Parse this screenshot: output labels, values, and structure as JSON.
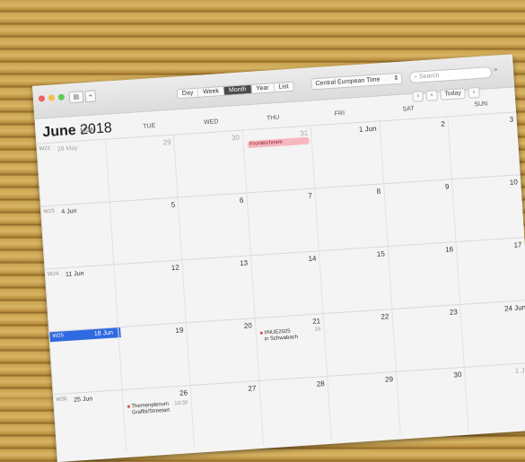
{
  "toolbar": {
    "views": [
      "Day",
      "Week",
      "Month",
      "Year",
      "List"
    ],
    "active_view": "Month",
    "timezone": "Central European Time",
    "search_placeholder": "Search",
    "today_label": "Today",
    "more": "»"
  },
  "title": {
    "month": "June",
    "year": "2018"
  },
  "dayheads": [
    "MON",
    "TUE",
    "WED",
    "THU",
    "FRI",
    "SAT",
    "SUN"
  ],
  "weeks": [
    {
      "label": "W22",
      "days": [
        {
          "n": "28 May",
          "muted": true
        },
        {
          "n": "29",
          "muted": true
        },
        {
          "n": "30",
          "muted": true
        },
        {
          "n": "31",
          "muted": true
        },
        {
          "n": "1 Jun"
        },
        {
          "n": "2"
        },
        {
          "n": "3"
        }
      ]
    },
    {
      "label": "W23",
      "days": [
        {
          "n": "4 Jun",
          "muted": false
        },
        {
          "n": "5"
        },
        {
          "n": "6"
        },
        {
          "n": "7"
        },
        {
          "n": "8"
        },
        {
          "n": "9"
        },
        {
          "n": "10"
        }
      ]
    },
    {
      "label": "W24",
      "days": [
        {
          "n": "11 Jun"
        },
        {
          "n": "12"
        },
        {
          "n": "13"
        },
        {
          "n": "14"
        },
        {
          "n": "15"
        },
        {
          "n": "16"
        },
        {
          "n": "17"
        }
      ]
    },
    {
      "label": "W25",
      "current": true,
      "days": [
        {
          "n": "18 Jun"
        },
        {
          "n": "19"
        },
        {
          "n": "20"
        },
        {
          "n": "21"
        },
        {
          "n": "22"
        },
        {
          "n": "23"
        },
        {
          "n": "24 Jun"
        }
      ]
    },
    {
      "label": "W26",
      "days": [
        {
          "n": "25 Jun"
        },
        {
          "n": "26"
        },
        {
          "n": "27"
        },
        {
          "n": "28"
        },
        {
          "n": "29"
        },
        {
          "n": "30"
        },
        {
          "n": "1 Jul",
          "muted": true
        }
      ]
    }
  ],
  "events": {
    "fronleichnam": "Fronleichnam",
    "nue_title": "#NUE2025",
    "nue_time": "19",
    "nue_loc": "in Schwabach",
    "thema_title": "Themenplenum",
    "thema_time": "19:30",
    "thema_loc": "Graffiti/Streetart"
  },
  "colors": {
    "accent": "#2f6ae0",
    "event_red": "#e0443f",
    "allday_pink": "#f7b8c0"
  }
}
